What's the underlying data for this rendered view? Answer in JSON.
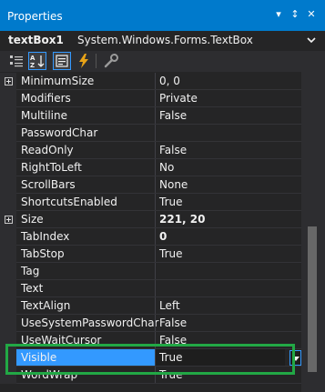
{
  "window": {
    "title": "Properties",
    "controls": [
      "▾",
      "↕",
      "✕"
    ]
  },
  "object_selector": {
    "name": "textBox1",
    "type": "System.Windows.Forms.TextBox"
  },
  "toolbar": {
    "buttons": [
      {
        "icon": "categorized-icon",
        "active": false
      },
      {
        "icon": "alphabetical-icon",
        "active": true
      },
      {
        "icon": "properties-icon",
        "active": true
      },
      {
        "icon": "events-icon",
        "active": false
      },
      {
        "icon": "property-pages-icon",
        "active": false
      }
    ]
  },
  "properties": [
    {
      "name": "MinimumSize",
      "value": "0, 0",
      "expandable": true,
      "bold": false
    },
    {
      "name": "Modifiers",
      "value": "Private",
      "expandable": false,
      "bold": false
    },
    {
      "name": "Multiline",
      "value": "False",
      "expandable": false,
      "bold": false
    },
    {
      "name": "PasswordChar",
      "value": "",
      "expandable": false,
      "bold": false
    },
    {
      "name": "ReadOnly",
      "value": "False",
      "expandable": false,
      "bold": false
    },
    {
      "name": "RightToLeft",
      "value": "No",
      "expandable": false,
      "bold": false
    },
    {
      "name": "ScrollBars",
      "value": "None",
      "expandable": false,
      "bold": false
    },
    {
      "name": "ShortcutsEnabled",
      "value": "True",
      "expandable": false,
      "bold": false
    },
    {
      "name": "Size",
      "value": "221, 20",
      "expandable": true,
      "bold": true
    },
    {
      "name": "TabIndex",
      "value": "0",
      "expandable": false,
      "bold": true
    },
    {
      "name": "TabStop",
      "value": "True",
      "expandable": false,
      "bold": false
    },
    {
      "name": "Tag",
      "value": "",
      "expandable": false,
      "bold": false
    },
    {
      "name": "Text",
      "value": "",
      "expandable": false,
      "bold": false
    },
    {
      "name": "TextAlign",
      "value": "Left",
      "expandable": false,
      "bold": false
    },
    {
      "name": "UseSystemPasswordChar",
      "value": "False",
      "expandable": false,
      "bold": false
    },
    {
      "name": "UseWaitCursor",
      "value": "False",
      "expandable": false,
      "bold": false
    },
    {
      "name": "Visible",
      "value": "True",
      "expandable": false,
      "bold": false,
      "selected": true
    },
    {
      "name": "WordWrap",
      "value": "True",
      "expandable": false,
      "bold": false
    }
  ],
  "colors": {
    "title_bar": "#007acc",
    "selection": "#3399ff",
    "annotation_box": "#22a845",
    "background": "#252526"
  }
}
